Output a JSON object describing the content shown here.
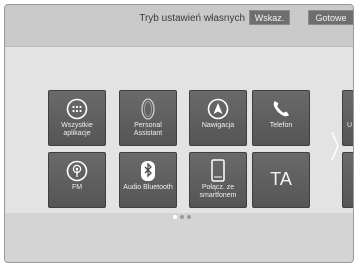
{
  "header": {
    "title": "Tryb ustawień własnych",
    "show_label": "Wskaz.",
    "done_label": "Gotowe"
  },
  "tiles_row1": [
    {
      "label": "Wszystkie aplikacje",
      "icon": "all-apps-icon"
    },
    {
      "label": "Personal Assistant",
      "icon": "assistant-icon"
    },
    {
      "label": "Nawigacja",
      "icon": "navigation-icon"
    },
    {
      "label": "Telefon",
      "icon": "phone-icon"
    },
    {
      "label": "U",
      "icon": ""
    }
  ],
  "tiles_row2": [
    {
      "label": "FM",
      "icon": "fm-radio-icon"
    },
    {
      "label": "Audio Bluetooth",
      "icon": "bluetooth-icon"
    },
    {
      "label": "Połącz. ze smartfonem",
      "icon": "smartphone-icon"
    },
    {
      "label": "TA",
      "icon": ""
    }
  ],
  "pagination": {
    "pages": 3,
    "current": 1
  }
}
